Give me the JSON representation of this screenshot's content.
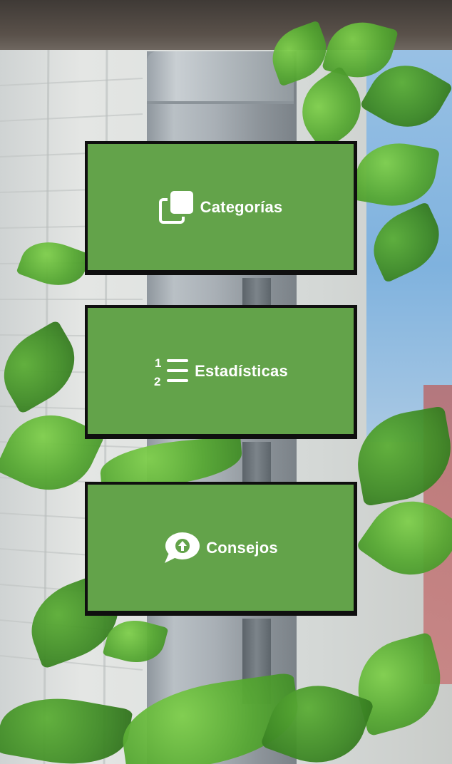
{
  "menu": {
    "items": [
      {
        "label": "Categorías",
        "icon": "copy-squares-icon"
      },
      {
        "label": "Estadísticas",
        "icon": "numbered-list-icon"
      },
      {
        "label": "Consejos",
        "icon": "speech-bubble-up-arrow-icon"
      }
    ]
  },
  "colors": {
    "button_fill": "#63a34a",
    "button_border": "#0f0f0f",
    "label_text": "#ffffff"
  }
}
